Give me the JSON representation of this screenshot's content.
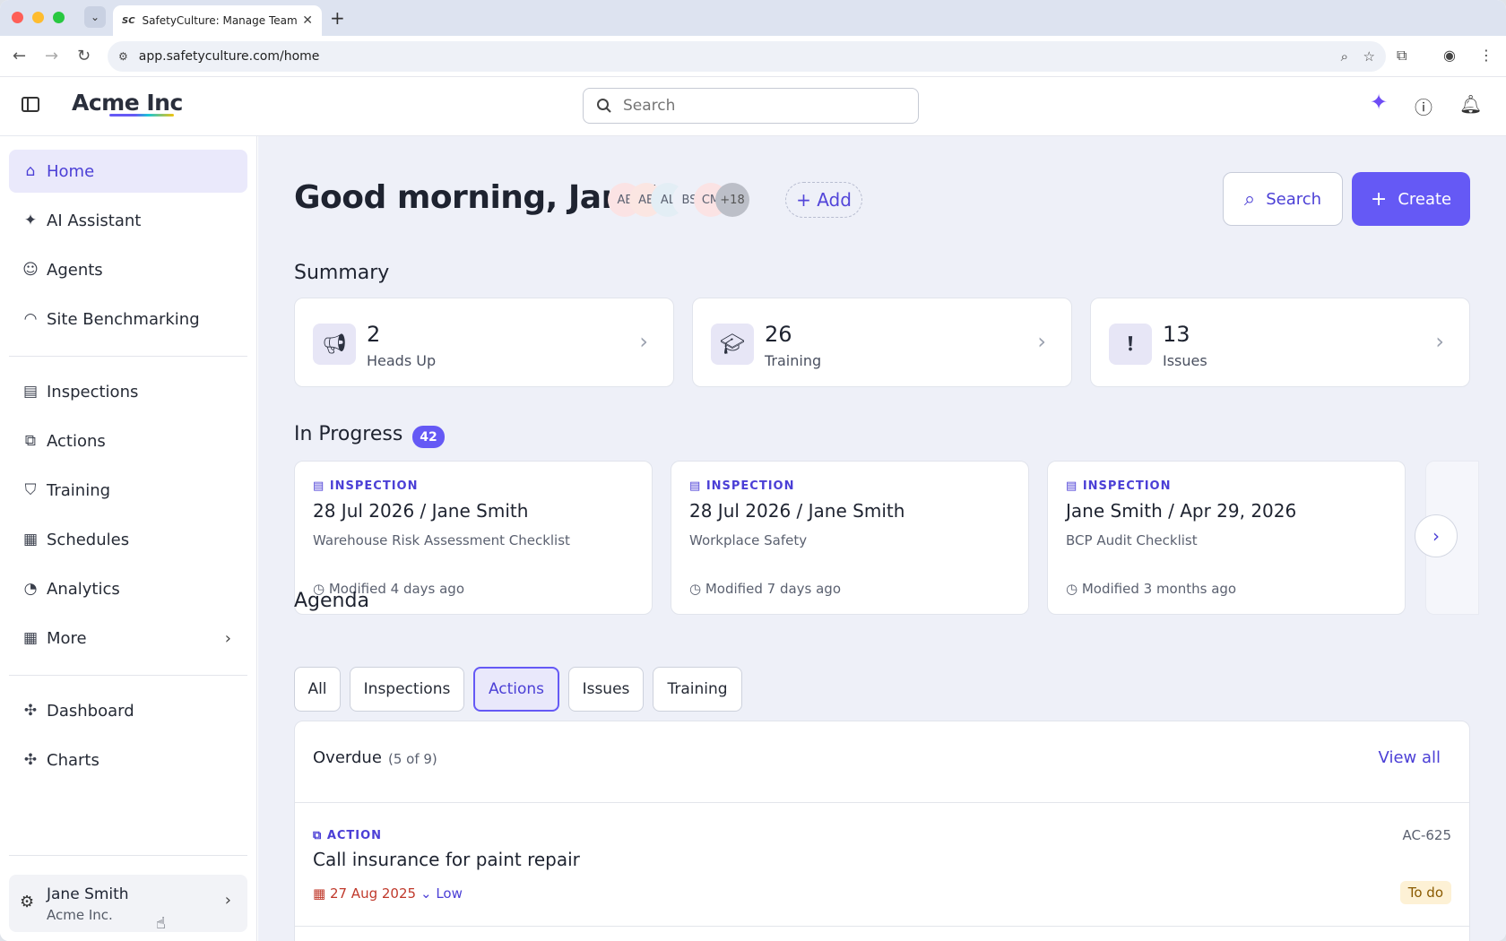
{
  "browser": {
    "tab_title": "SafetyCulture: Manage Teams",
    "tab_favicon": "SC",
    "url": "app.safetyculture.com/home"
  },
  "header": {
    "logo": "Acme Inc",
    "search_placeholder": "Search"
  },
  "sidebar": {
    "items": [
      {
        "label": "Home",
        "icon": "home-icon"
      },
      {
        "label": "AI Assistant",
        "icon": "sparkle-icon"
      },
      {
        "label": "Agents",
        "icon": "robot-icon"
      },
      {
        "label": "Site Benchmarking",
        "icon": "gauge-icon"
      },
      {
        "label": "Inspections",
        "icon": "clipboard-icon"
      },
      {
        "label": "Actions",
        "icon": "actions-icon"
      },
      {
        "label": "Training",
        "icon": "graduation-cap-icon"
      },
      {
        "label": "Schedules",
        "icon": "calendar-icon"
      },
      {
        "label": "Analytics",
        "icon": "pie-chart-icon"
      },
      {
        "label": "More",
        "icon": "grid-icon"
      },
      {
        "label": "Dashboard",
        "icon": "puzzle-icon"
      },
      {
        "label": "Charts",
        "icon": "puzzle-icon"
      }
    ],
    "user": {
      "name": "Jane Smith",
      "org": "Acme Inc."
    }
  },
  "main": {
    "greeting": "Good morning, Jane!",
    "avatars": [
      "AE",
      "AB",
      "AL",
      "BS",
      "CM",
      "+18"
    ],
    "add_label": "+ Add",
    "search_button": "Search",
    "create_button": "Create",
    "summary_title": "Summary",
    "summary": [
      {
        "count": "2",
        "label": "Heads Up",
        "icon": "megaphone-icon"
      },
      {
        "count": "26",
        "label": "Training",
        "icon": "graduation-cap-icon"
      },
      {
        "count": "13",
        "label": "Issues",
        "icon": "alert-bubble-icon"
      }
    ],
    "in_progress_title": "In Progress",
    "in_progress_count": "42",
    "in_progress": [
      {
        "type": "INSPECTION",
        "title": "28 Jul 2026 / Jane Smith",
        "subtitle": "Warehouse Risk Assessment Checklist",
        "modified": "Modified 4 days ago"
      },
      {
        "type": "INSPECTION",
        "title": "28 Jul 2026 / Jane Smith",
        "subtitle": "Workplace Safety",
        "modified": "Modified 7 days ago"
      },
      {
        "type": "INSPECTION",
        "title": "Jane Smith / Apr 29, 2026",
        "subtitle": "BCP Audit Checklist",
        "modified": "Modified 3 months ago"
      }
    ],
    "agenda_title": "Agenda",
    "agenda_filters": [
      "All",
      "Inspections",
      "Actions",
      "Issues",
      "Training"
    ],
    "agenda_active": "Actions",
    "overdue": {
      "title": "Overdue",
      "count": "(5 of 9)",
      "view_all": "View all",
      "item": {
        "type": "ACTION",
        "id": "AC-625",
        "title": "Call insurance for paint repair",
        "date": "27 Aug 2025",
        "priority": "Low",
        "status": "To do"
      }
    }
  }
}
